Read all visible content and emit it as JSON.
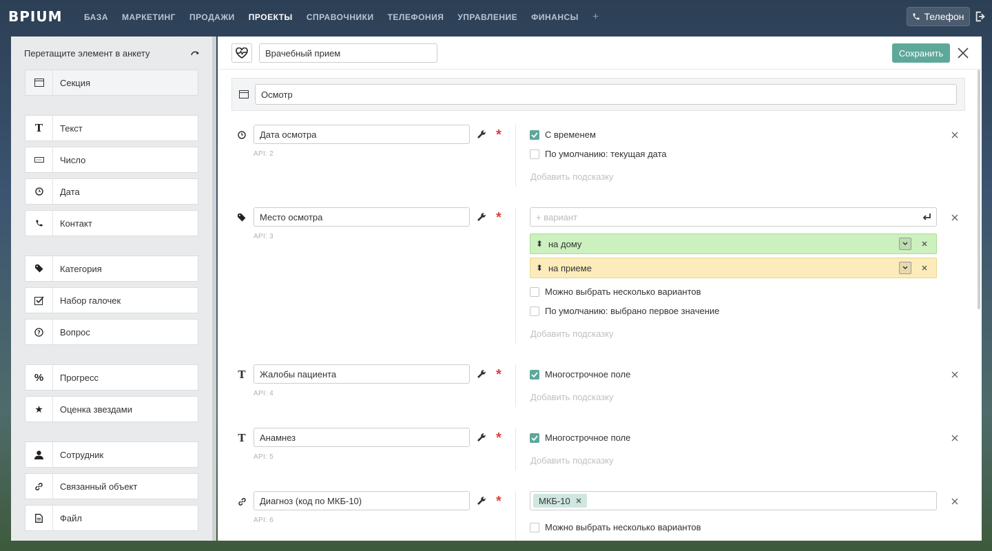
{
  "app": {
    "logo": "BPIUM"
  },
  "nav": {
    "items": [
      {
        "label": "БАЗА",
        "active": false
      },
      {
        "label": "МАРКЕТИНГ",
        "active": false
      },
      {
        "label": "ПРОДАЖИ",
        "active": false
      },
      {
        "label": "ПРОЕКТЫ",
        "active": true
      },
      {
        "label": "СПРАВОЧНИКИ",
        "active": false
      },
      {
        "label": "ТЕЛЕФОНИЯ",
        "active": false
      },
      {
        "label": "УПРАВЛЕНИЕ",
        "active": false
      },
      {
        "label": "ФИНАНСЫ",
        "active": false
      }
    ],
    "plus": "+",
    "phone_label": "Телефон"
  },
  "palette": {
    "header": "Перетащите элемент в анкету",
    "items": [
      {
        "label": "Секция",
        "icon": "section-icon"
      },
      {
        "label": "Текст",
        "icon": "text-icon"
      },
      {
        "label": "Число",
        "icon": "number-icon"
      },
      {
        "label": "Дата",
        "icon": "clock-icon"
      },
      {
        "label": "Контакт",
        "icon": "phone-icon"
      },
      {
        "label": "Категория",
        "icon": "tag-icon"
      },
      {
        "label": "Набор галочек",
        "icon": "checkbox-icon"
      },
      {
        "label": "Вопрос",
        "icon": "question-icon"
      },
      {
        "label": "Прогресс",
        "icon": "percent-icon"
      },
      {
        "label": "Оценка звездами",
        "icon": "star-icon"
      },
      {
        "label": "Сотрудник",
        "icon": "user-icon"
      },
      {
        "label": "Связанный объект",
        "icon": "link-icon"
      },
      {
        "label": "Файл",
        "icon": "file-icon"
      }
    ]
  },
  "editor": {
    "title": "Врачебный прием",
    "save_label": "Сохранить",
    "section_title": "Осмотр",
    "hint_placeholder": "Добавить подсказку",
    "fields": [
      {
        "name": "Дата осмотра",
        "api": "API: 2",
        "icon": "clock-icon",
        "options": [
          {
            "label": "С временем",
            "checked": true
          },
          {
            "label": "По умолчанию: текущая дата",
            "checked": false
          }
        ]
      },
      {
        "name": "Место осмотра",
        "api": "API: 3",
        "icon": "tag-icon",
        "variant_placeholder": "+ вариант",
        "variants": [
          {
            "label": "на дому",
            "color": "#cdf0bf"
          },
          {
            "label": "на приеме",
            "color": "#fcecbb"
          }
        ],
        "options": [
          {
            "label": "Можно выбрать несколько вариантов",
            "checked": false
          },
          {
            "label": "По умолчанию: выбрано первое значение",
            "checked": false
          }
        ]
      },
      {
        "name": "Жалобы пациента",
        "api": "API: 4",
        "icon": "text-icon",
        "options": [
          {
            "label": "Многострочное поле",
            "checked": true
          }
        ]
      },
      {
        "name": "Анамнез",
        "api": "API: 5",
        "icon": "text-icon",
        "options": [
          {
            "label": "Многострочное поле",
            "checked": true
          }
        ]
      },
      {
        "name": "Диагноз (код по МКБ-10)",
        "api": "API: 6",
        "icon": "link-icon",
        "tags": [
          "МКБ-10"
        ],
        "options": [
          {
            "label": "Можно выбрать несколько вариантов",
            "checked": false
          }
        ]
      }
    ]
  },
  "colors": {
    "accent": "#5ea89a",
    "required": "#d9433d"
  }
}
